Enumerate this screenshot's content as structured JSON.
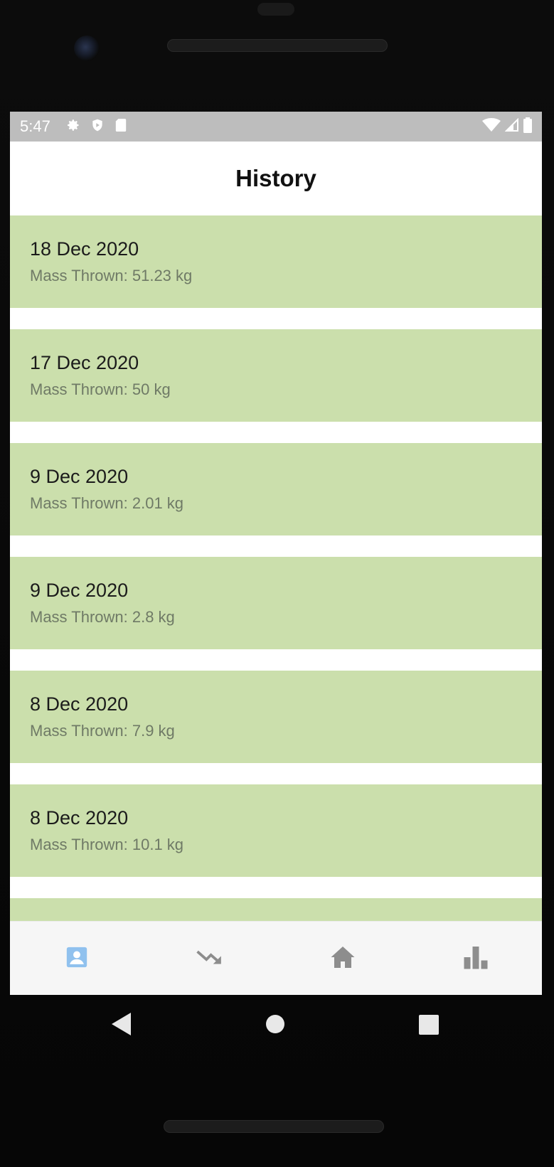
{
  "status_bar": {
    "time": "5:47",
    "icons_left": [
      "gear-icon",
      "shield-icon",
      "sd-card-icon"
    ],
    "icons_right": [
      "wifi-icon",
      "signal-icon",
      "battery-icon"
    ]
  },
  "app_bar": {
    "title": "History"
  },
  "history": [
    {
      "date": "18 Dec 2020",
      "mass": "Mass Thrown: 51.23 kg"
    },
    {
      "date": "17 Dec 2020",
      "mass": "Mass Thrown: 50 kg"
    },
    {
      "date": "9 Dec 2020",
      "mass": "Mass Thrown: 2.01 kg"
    },
    {
      "date": "9 Dec 2020",
      "mass": "Mass Thrown: 2.8 kg"
    },
    {
      "date": "8 Dec 2020",
      "mass": "Mass Thrown: 7.9 kg"
    },
    {
      "date": "8 Dec 2020",
      "mass": "Mass Thrown: 10.1 kg"
    }
  ],
  "bottom_nav": {
    "items": [
      {
        "icon": "profile-icon",
        "active": true
      },
      {
        "icon": "trending-down-icon",
        "active": false
      },
      {
        "icon": "home-icon",
        "active": false
      },
      {
        "icon": "bar-chart-icon",
        "active": false
      }
    ]
  },
  "colors": {
    "card_bg": "#cbdfac",
    "nav_active": "#90c1ee",
    "nav_inactive": "#8d8d8d",
    "status_bar": "#bdbdbd"
  },
  "system_nav": [
    "back-icon",
    "home-circle-icon",
    "recents-icon"
  ]
}
